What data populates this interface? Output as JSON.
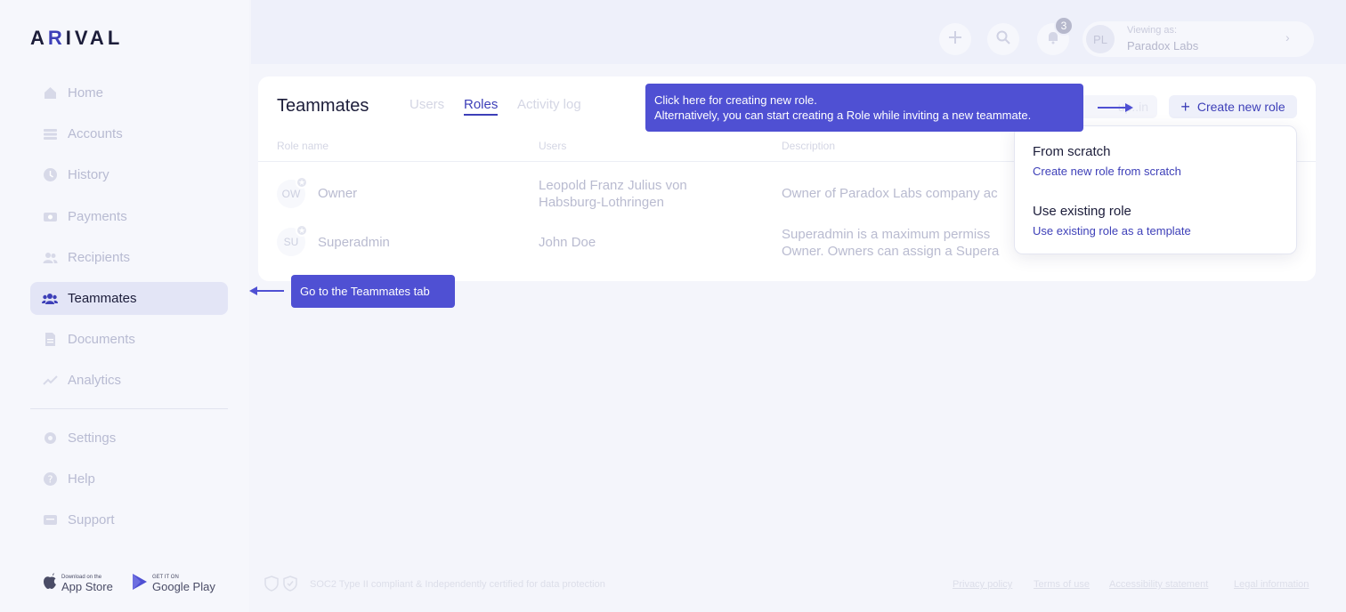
{
  "brand": {
    "logo_a": "A",
    "logo_r": "R",
    "logo_rest": "IVAL"
  },
  "sidebar": {
    "items": [
      {
        "label": "Home",
        "icon": "home-icon"
      },
      {
        "label": "Accounts",
        "icon": "accounts-icon"
      },
      {
        "label": "History",
        "icon": "history-icon"
      },
      {
        "label": "Payments",
        "icon": "payments-icon"
      },
      {
        "label": "Recipients",
        "icon": "recipients-icon"
      },
      {
        "label": "Teammates",
        "icon": "teammates-icon",
        "active": true
      },
      {
        "label": "Documents",
        "icon": "documents-icon"
      },
      {
        "label": "Analytics",
        "icon": "analytics-icon"
      }
    ],
    "secondary": [
      {
        "label": "Settings",
        "icon": "gear-icon"
      },
      {
        "label": "Help",
        "icon": "help-icon"
      },
      {
        "label": "Support",
        "icon": "support-icon"
      }
    ],
    "app_store": {
      "small": "Download on the",
      "big": "App Store"
    },
    "google_play": {
      "small": "GET IT ON",
      "big": "Google Play"
    }
  },
  "topbar": {
    "notifications_count": "3",
    "avatar_initials": "PL",
    "viewing_label": "Viewing as:",
    "viewing_org": "Paradox Labs"
  },
  "teammates": {
    "title": "Teammates",
    "tabs": [
      "Users",
      "Roles",
      "Activity log"
    ],
    "active_tab": "Roles",
    "ghost_button": "Invite teammate",
    "ghost_button_visible": "up..in",
    "create_button": "Create new role",
    "columns": [
      "Role name",
      "Users",
      "Description"
    ],
    "rows": [
      {
        "initials": "OW",
        "role": "Owner",
        "users_line1": "Leopold Franz Julius von",
        "users_line2": "Habsburg-Lothringen",
        "desc_line1": "Owner of Paradox Labs company ac",
        "desc_line2": ""
      },
      {
        "initials": "SU",
        "role": "Superadmin",
        "users_line1": "John Doe",
        "users_line2": "",
        "desc_line1": "Superadmin is a maximum permiss",
        "desc_line2": "Owner. Owners can assign a Supera"
      }
    ]
  },
  "dropdown": {
    "items": [
      {
        "title": "From scratch",
        "subtitle": "Create new role from scratch"
      },
      {
        "title": "Use existing role",
        "subtitle": "Use existing role as a template"
      }
    ]
  },
  "tooltips": {
    "create_role_line1": "Click here for creating new role.",
    "create_role_line2": "Alternatively, you can start creating a Role while inviting a new teammate.",
    "teammates_tab": "Go to the Teammates tab"
  },
  "footer": {
    "compliance": "SOC2 Type II compliant & Independently certified for data protection",
    "links": [
      "Privacy policy",
      "Terms of use",
      "Accessibility statement",
      "Legal information"
    ]
  },
  "colors": {
    "accent": "#3d3fb8",
    "tooltip": "#4f50d3",
    "active_nav_bg": "#e3e5f6"
  }
}
